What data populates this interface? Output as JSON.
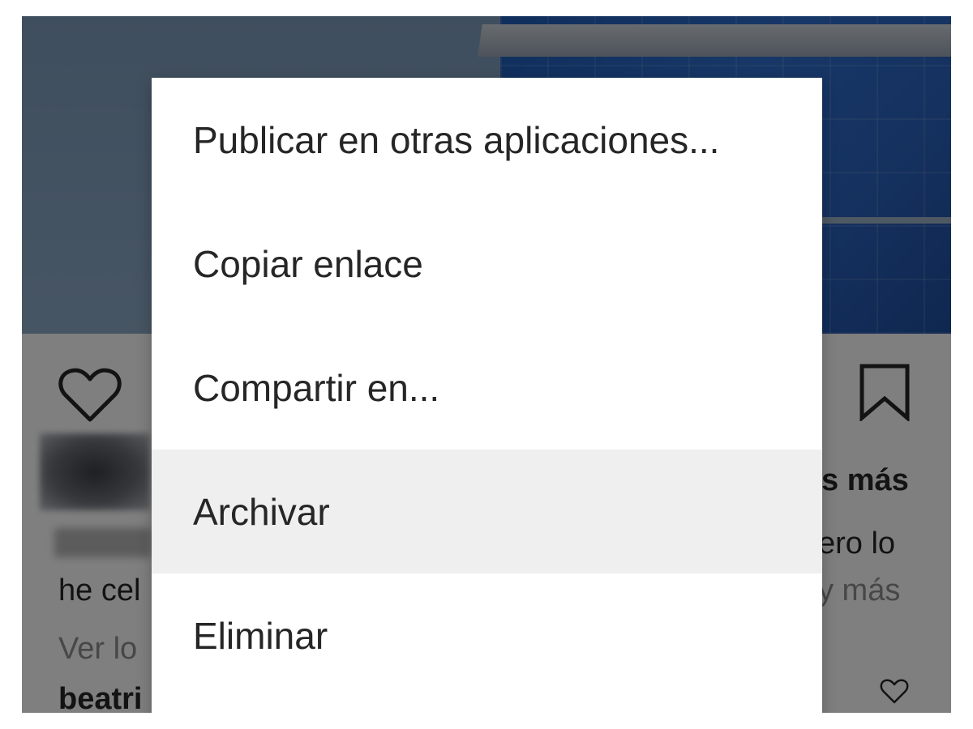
{
  "post": {
    "caption_fragments": {
      "line1_right": "s más",
      "line2_right": "ero lo",
      "line3_left": "he cel",
      "line3_right": "y más",
      "line4_left": "Ver lo",
      "line5_left": "beatri"
    },
    "icons": {
      "like": "heart-outline-icon",
      "save": "bookmark-outline-icon",
      "comment_like": "heart-outline-icon"
    }
  },
  "menu": {
    "items": [
      {
        "label": "Publicar en otras aplicaciones..."
      },
      {
        "label": "Copiar enlace"
      },
      {
        "label": "Compartir en..."
      },
      {
        "label": "Archivar",
        "highlighted": true
      },
      {
        "label": "Eliminar"
      }
    ]
  }
}
